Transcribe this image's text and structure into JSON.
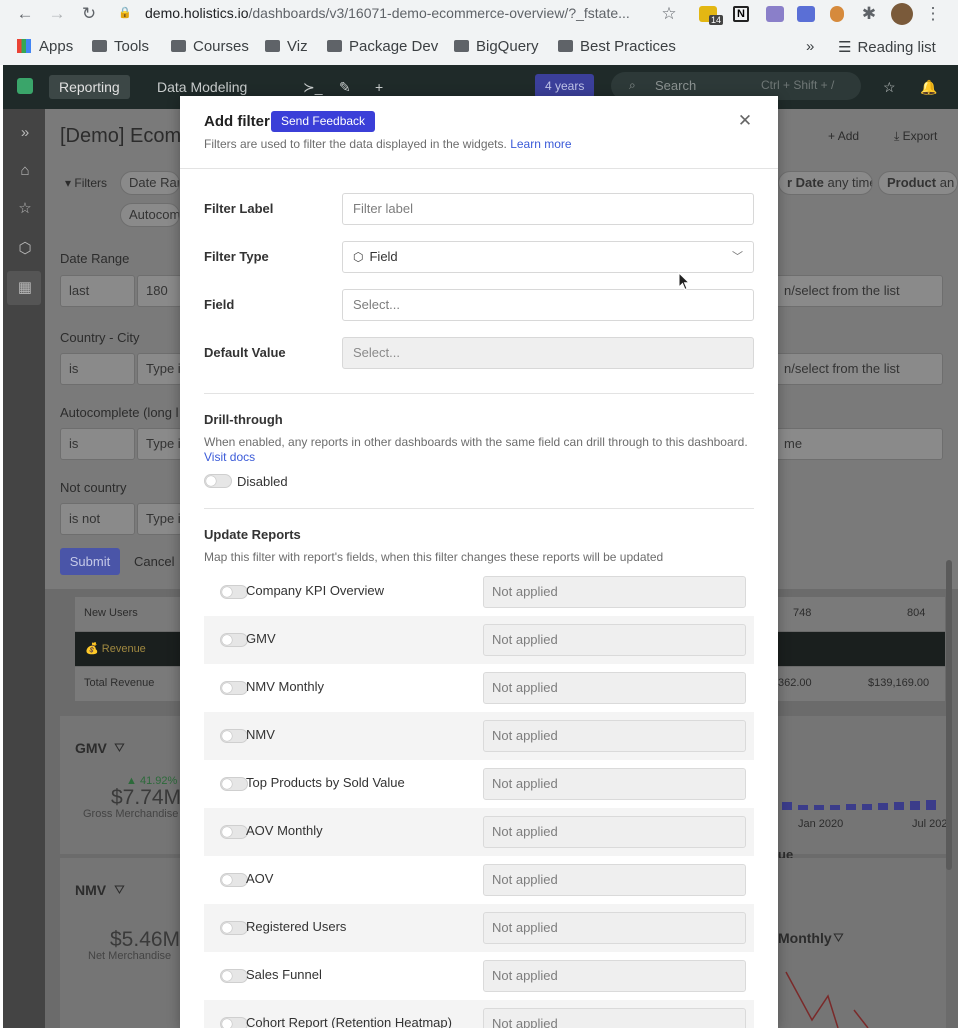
{
  "browser": {
    "url_main": "demo.holistics.io",
    "url_rest": "/dashboards/v3/16071-demo-ecommerce-overview/?_fstate...",
    "bookmarks": [
      "Apps",
      "Tools",
      "Courses",
      "Viz",
      "Package Dev",
      "BigQuery",
      "Best Practices"
    ],
    "more": "»",
    "reading_list": "Reading list",
    "ext_badge_count": "14"
  },
  "app": {
    "tabs": [
      "Reporting",
      "Data Modeling"
    ],
    "time_badge": "4 years",
    "search_placeholder": "Search",
    "search_shortcut": "Ctrl + Shift + /"
  },
  "background": {
    "dashboard_title": "[Demo] Ecom",
    "add_label": "Add",
    "export_label": "Export",
    "filters_label": "Filters",
    "filter_chip_1": "Date Ran",
    "filter_chip_2": "Autocom",
    "right_chip_1_key": "r Date",
    "right_chip_1_val": "any time",
    "right_chip_2_key": "Product",
    "right_chip_2_val": "an",
    "date_range_label": "Date Range",
    "date_range_op": "last",
    "date_range_val": "180",
    "country_city_label": "Country - City",
    "country_city_op": "is",
    "autocomplete_label": "Autocomplete (long l",
    "autocomplete_op": "is",
    "not_country_label": "Not country",
    "not_country_op": "is not",
    "type_in": "Type i",
    "select_from_list": "n/select from the list",
    "time_placeholder": "me",
    "submit": "Submit",
    "cancel": "Cancel",
    "new_users_label": "New Users",
    "new_users_v1": "748",
    "new_users_v2": "804",
    "revenue_section": "Revenue",
    "total_revenue_label": "Total Revenue",
    "total_revenue_v1": "362.00",
    "total_revenue_v2": "$139,169.00",
    "gmv_title": "GMV",
    "gmv_change": "41.92%",
    "gmv_value": "$7.74M",
    "gmv_sub": "Gross Merchandise",
    "nmv_title": "NMV",
    "nmv_value": "$5.46M",
    "nmv_sub": "Net Merchandise",
    "axis_jan": "Jan 2020",
    "axis_jul": "Jul 202",
    "chart_title_1": "ue",
    "chart_title_2": "Monthly"
  },
  "modal": {
    "title": "Add filter",
    "feedback_button": "Send Feedback",
    "subtitle": "Filters are used to filter the data displayed in the widgets.",
    "learn_more": "Learn more",
    "filter_label_label": "Filter Label",
    "filter_label_placeholder": "Filter label",
    "filter_type_label": "Filter Type",
    "filter_type_value": "Field",
    "field_label": "Field",
    "field_placeholder": "Select...",
    "default_value_label": "Default Value",
    "default_value_placeholder": "Select...",
    "drill_title": "Drill-through",
    "drill_desc": "When enabled, any reports in other dashboards with the same field can drill through to this dashboard.",
    "visit_docs": "Visit docs",
    "drill_state": "Disabled",
    "update_title": "Update Reports",
    "update_desc": "Map this filter with report's fields, when this filter changes these reports will be updated",
    "reports": [
      {
        "name": "Company KPI Overview",
        "status": "Not applied"
      },
      {
        "name": "GMV",
        "status": "Not applied"
      },
      {
        "name": "NMV Monthly",
        "status": "Not applied"
      },
      {
        "name": "NMV",
        "status": "Not applied"
      },
      {
        "name": "Top Products by Sold Value",
        "status": "Not applied"
      },
      {
        "name": "AOV Monthly",
        "status": "Not applied"
      },
      {
        "name": "AOV",
        "status": "Not applied"
      },
      {
        "name": "Registered Users",
        "status": "Not applied"
      },
      {
        "name": "Sales Funnel",
        "status": "Not applied"
      },
      {
        "name": "Cohort Report (Retention Heatmap)",
        "status": "Not applied"
      }
    ]
  }
}
